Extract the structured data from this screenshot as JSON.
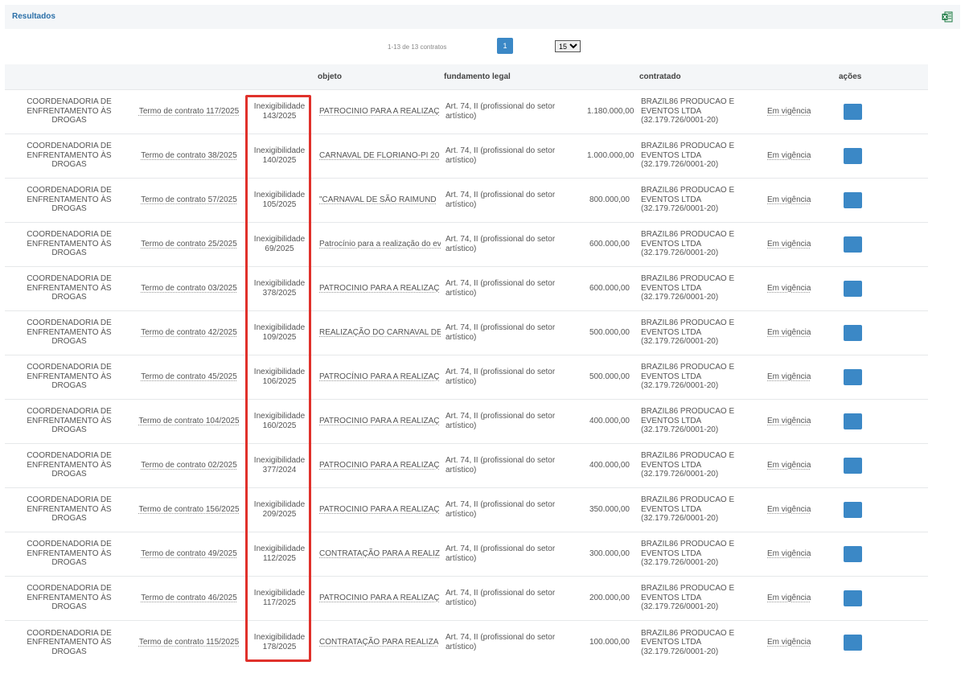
{
  "header": {
    "title": "Resultados",
    "export_icon": "excel-icon"
  },
  "pagination": {
    "range_text": "1-13 de 13 contratos",
    "current_page": "1",
    "page_size": "15",
    "page_size_options": [
      "15"
    ]
  },
  "columns": {
    "orgao": "",
    "termo": "",
    "processo": "",
    "objeto": "objeto",
    "fundamento": "fundamento legal",
    "valor": "",
    "contratado": "contratado",
    "status": "",
    "acoes": "ações"
  },
  "rows": [
    {
      "orgao": "COORDENADORIA DE ENFRENTAMENTO ÀS DROGAS",
      "termo": "Termo de contrato 117/2025",
      "processo": "Inexigibilidade 143/2025",
      "objeto": "PATROCINIO PARA A REALIZAÇ",
      "fundamento": "Art. 74, II (profissional do setor artístico)",
      "valor": "1.180.000,00",
      "contratado": "BRAZIL86 PRODUCAO E EVENTOS LTDA (32.179.726/0001-20)",
      "status": "Em vigência"
    },
    {
      "orgao": "COORDENADORIA DE ENFRENTAMENTO ÀS DROGAS",
      "termo": "Termo de contrato 38/2025",
      "processo": "Inexigibilidade 140/2025",
      "objeto": "CARNAVAL DE FLORIANO-PI 20",
      "fundamento": "Art. 74, II (profissional do setor artístico)",
      "valor": "1.000.000,00",
      "contratado": "BRAZIL86 PRODUCAO E EVENTOS LTDA (32.179.726/0001-20)",
      "status": "Em vigência"
    },
    {
      "orgao": "COORDENADORIA DE ENFRENTAMENTO ÀS DROGAS",
      "termo": "Termo de contrato 57/2025",
      "processo": "Inexigibilidade 105/2025",
      "objeto": "\"CARNAVAL DE SÃO RAIMUND",
      "fundamento": "Art. 74, II (profissional do setor artístico)",
      "valor": "800.000,00",
      "contratado": "BRAZIL86 PRODUCAO E EVENTOS LTDA (32.179.726/0001-20)",
      "status": "Em vigência"
    },
    {
      "orgao": "COORDENADORIA DE ENFRENTAMENTO ÀS DROGAS",
      "termo": "Termo de contrato 25/2025",
      "processo": "Inexigibilidade 69/2025",
      "objeto": "Patrocínio para a realização do ev",
      "fundamento": "Art. 74, II (profissional do setor artístico)",
      "valor": "600.000,00",
      "contratado": "BRAZIL86 PRODUCAO E EVENTOS LTDA (32.179.726/0001-20)",
      "status": "Em vigência"
    },
    {
      "orgao": "COORDENADORIA DE ENFRENTAMENTO ÀS DROGAS",
      "termo": "Termo de contrato 03/2025",
      "processo": "Inexigibilidade 378/2025",
      "objeto": "PATROCINIO PARA A REALIZAÇ",
      "fundamento": "Art. 74, II (profissional do setor artístico)",
      "valor": "600.000,00",
      "contratado": "BRAZIL86 PRODUCAO E EVENTOS LTDA (32.179.726/0001-20)",
      "status": "Em vigência"
    },
    {
      "orgao": "COORDENADORIA DE ENFRENTAMENTO ÀS DROGAS",
      "termo": "Termo de contrato 42/2025",
      "processo": "Inexigibilidade 109/2025",
      "objeto": "REALIZAÇÃO DO CARNAVAL DE",
      "fundamento": "Art. 74, II (profissional do setor artístico)",
      "valor": "500.000,00",
      "contratado": "BRAZIL86 PRODUCAO E EVENTOS LTDA (32.179.726/0001-20)",
      "status": "Em vigência"
    },
    {
      "orgao": "COORDENADORIA DE ENFRENTAMENTO ÀS DROGAS",
      "termo": "Termo de contrato 45/2025",
      "processo": "Inexigibilidade 106/2025",
      "objeto": "PATROCÍNIO PARA A REALIZAÇ",
      "fundamento": "Art. 74, II (profissional do setor artístico)",
      "valor": "500.000,00",
      "contratado": "BRAZIL86 PRODUCAO E EVENTOS LTDA (32.179.726/0001-20)",
      "status": "Em vigência"
    },
    {
      "orgao": "COORDENADORIA DE ENFRENTAMENTO ÀS DROGAS",
      "termo": "Termo de contrato 104/2025",
      "processo": "Inexigibilidade 160/2025",
      "objeto": "PATROCINIO PARA A REALIZAÇ",
      "fundamento": "Art. 74, II (profissional do setor artístico)",
      "valor": "400.000,00",
      "contratado": "BRAZIL86 PRODUCAO E EVENTOS LTDA (32.179.726/0001-20)",
      "status": "Em vigência"
    },
    {
      "orgao": "COORDENADORIA DE ENFRENTAMENTO ÀS DROGAS",
      "termo": "Termo de contrato 02/2025",
      "processo": "Inexigibilidade 377/2024",
      "objeto": "PATROCINIO PARA A REALIZAÇ",
      "fundamento": "Art. 74, II (profissional do setor artístico)",
      "valor": "400.000,00",
      "contratado": "BRAZIL86 PRODUCAO E EVENTOS LTDA (32.179.726/0001-20)",
      "status": "Em vigência"
    },
    {
      "orgao": "COORDENADORIA DE ENFRENTAMENTO ÀS DROGAS",
      "termo": "Termo de contrato 156/2025",
      "processo": "Inexigibilidade 209/2025",
      "objeto": "PATROCINIO PARA A REALIZAÇ",
      "fundamento": "Art. 74, II (profissional do setor artístico)",
      "valor": "350.000,00",
      "contratado": "BRAZIL86 PRODUCAO E EVENTOS LTDA (32.179.726/0001-20)",
      "status": "Em vigência"
    },
    {
      "orgao": "COORDENADORIA DE ENFRENTAMENTO ÀS DROGAS",
      "termo": "Termo de contrato 49/2025",
      "processo": "Inexigibilidade 112/2025",
      "objeto": "CONTRATAÇÃO PARA A REALIZ",
      "fundamento": "Art. 74, II (profissional do setor artístico)",
      "valor": "300.000,00",
      "contratado": "BRAZIL86 PRODUCAO E EVENTOS LTDA (32.179.726/0001-20)",
      "status": "Em vigência"
    },
    {
      "orgao": "COORDENADORIA DE ENFRENTAMENTO ÀS DROGAS",
      "termo": "Termo de contrato 46/2025",
      "processo": "Inexigibilidade 117/2025",
      "objeto": "PATROCINIO PARA A REALIZAÇ",
      "fundamento": "Art. 74, II (profissional do setor artístico)",
      "valor": "200.000,00",
      "contratado": "BRAZIL86 PRODUCAO E EVENTOS LTDA (32.179.726/0001-20)",
      "status": "Em vigência"
    },
    {
      "orgao": "COORDENADORIA DE ENFRENTAMENTO ÀS DROGAS",
      "termo": "Termo de contrato 115/2025",
      "processo": "Inexigibilidade 178/2025",
      "objeto": "CONTRATAÇÃO PARA REALIZA",
      "fundamento": "Art. 74, II (profissional do setor artístico)",
      "valor": "100.000,00",
      "contratado": "BRAZIL86 PRODUCAO E EVENTOS LTDA (32.179.726/0001-20)",
      "status": "Em vigência"
    }
  ],
  "colors": {
    "accent": "#3b88c6",
    "highlight": "#e0312b",
    "title": "#2a6fa8",
    "excel": "#1d7a45"
  }
}
